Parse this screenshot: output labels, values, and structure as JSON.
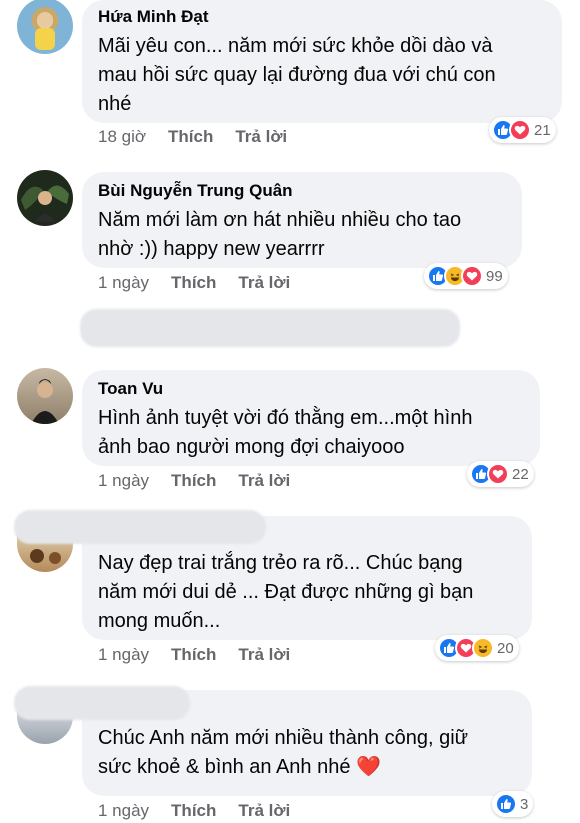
{
  "labels": {
    "like": "Thích",
    "reply": "Trả lời"
  },
  "comments": [
    {
      "author": "Hứa Minh Đạt",
      "lines": [
        "Mãi yêu con... năm mới sức khỏe dồi dào và",
        "mau hồi sức quay lại đường đua với chú con",
        "nhé"
      ],
      "time": "18 giờ",
      "reactions": [
        "like",
        "love"
      ],
      "reaction_count": "21"
    },
    {
      "author": "Bùi Nguyễn Trung Quân",
      "lines": [
        "Năm mới làm ơn hát nhiều nhiều cho tao",
        "nhờ :)) happy new yearrrr"
      ],
      "time": "1 ngày",
      "reactions": [
        "like",
        "haha",
        "love"
      ],
      "reaction_count": "99"
    },
    {
      "author": "Toan Vu",
      "lines": [
        "Hình ảnh tuyệt vời đó thằng em...một hình",
        "ảnh bao người mong đợi chaiyooo"
      ],
      "time": "1 ngày",
      "reactions": [
        "like",
        "love"
      ],
      "reaction_count": "22"
    },
    {
      "author": "",
      "lines": [
        "Nay đẹp trai trắng trẻo ra rõ... Chúc bạng",
        "năm mới dui dẻ ... Đạt được những gì bạn",
        "mong muốn..."
      ],
      "time": "1 ngày",
      "reactions": [
        "like",
        "love",
        "haha"
      ],
      "reaction_count": "20"
    },
    {
      "author": "",
      "lines": [
        "Chúc Anh năm mới nhiều thành công, giữ",
        "sức khoẻ & bình an Anh nhé ❤️"
      ],
      "time": "1 ngày",
      "reactions": [
        "like"
      ],
      "reaction_count": "3"
    }
  ],
  "colors": {
    "like": "#1877f2",
    "love": "#f33e58",
    "haha": "#f7b928",
    "bubble": "#f0f2f5",
    "meta": "#65676b"
  },
  "icons": {
    "like": "thumbs-up-icon",
    "love": "heart-icon",
    "haha": "laughing-face-icon"
  }
}
